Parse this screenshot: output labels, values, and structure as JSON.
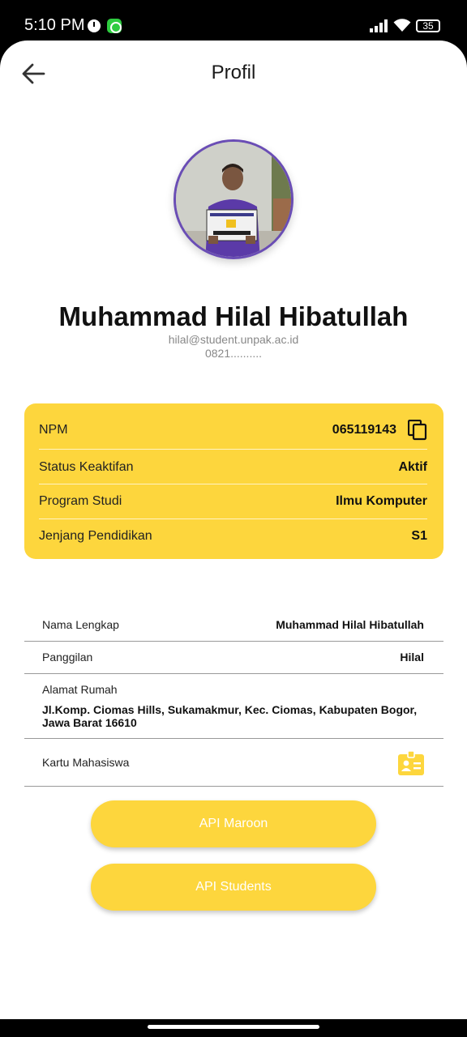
{
  "status_bar": {
    "time": "5:10 PM",
    "battery": "35"
  },
  "header": {
    "title": "Profil"
  },
  "profile": {
    "name": "Muhammad Hilal Hibatullah",
    "email": "hilal@student.unpak.ac.id",
    "phone": "0821.........."
  },
  "academic_card": {
    "npm_label": "NPM",
    "npm_value": "065119143",
    "status_label": "Status Keaktifan",
    "status_value": "Aktif",
    "program_label": "Program Studi",
    "program_value": "Ilmu Komputer",
    "level_label": "Jenjang Pendidikan",
    "level_value": "S1"
  },
  "details": {
    "full_name_label": "Nama Lengkap",
    "full_name_value": "Muhammad Hilal Hibatullah",
    "nickname_label": "Panggilan",
    "nickname_value": "Hilal",
    "address_label": "Alamat Rumah",
    "address_value": "Jl.Komp. Ciomas Hills, Sukamakmur, Kec. Ciomas, Kabupaten Bogor, Jawa Barat 16610",
    "student_card_label": "Kartu Mahasiswa"
  },
  "buttons": {
    "api_maroon": "API Maroon",
    "api_students": "API Students"
  },
  "colors": {
    "accent": "#fdd63d",
    "avatar_ring": "#6a4db5"
  },
  "icons": {
    "back": "arrow-left-icon",
    "copy": "copy-icon",
    "student_card": "id-card-icon"
  }
}
